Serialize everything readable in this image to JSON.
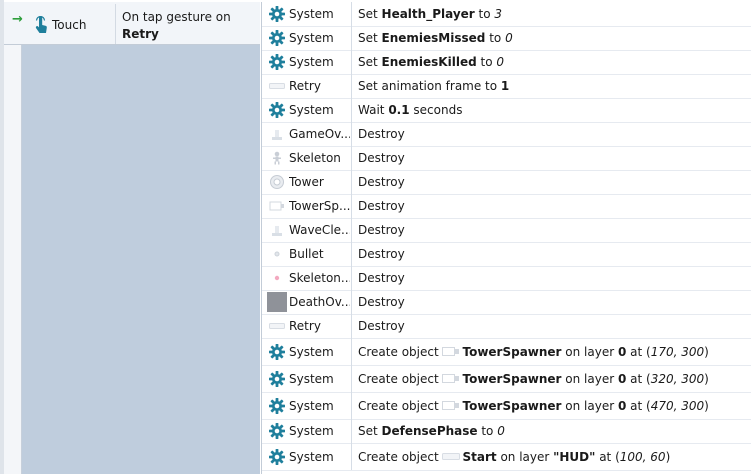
{
  "event": {
    "condition": {
      "object": "Touch",
      "text_line1": "On tap gesture on",
      "text_line2": "Retry"
    }
  },
  "actions": [
    {
      "icon": "gear-icon",
      "object": "System",
      "parts": [
        {
          "t": "Set "
        },
        {
          "b": "Health_Player"
        },
        {
          "t": " to "
        },
        {
          "i": "3"
        }
      ]
    },
    {
      "icon": "gear-icon",
      "object": "System",
      "parts": [
        {
          "t": "Set "
        },
        {
          "b": "EnemiesMissed"
        },
        {
          "t": " to "
        },
        {
          "i": "0"
        }
      ]
    },
    {
      "icon": "gear-icon",
      "object": "System",
      "parts": [
        {
          "t": "Set "
        },
        {
          "b": "EnemiesKilled"
        },
        {
          "t": " to "
        },
        {
          "i": "0"
        }
      ]
    },
    {
      "icon": "button-sprite-icon",
      "object": "Retry",
      "parts": [
        {
          "t": "Set animation frame to "
        },
        {
          "b": "1"
        }
      ]
    },
    {
      "icon": "gear-icon",
      "object": "System",
      "parts": [
        {
          "t": "Wait "
        },
        {
          "b": "0.1"
        },
        {
          "t": " seconds"
        }
      ]
    },
    {
      "icon": "sprite-icon",
      "object": "GameOv...",
      "parts": [
        {
          "t": "Destroy"
        }
      ]
    },
    {
      "icon": "skeleton-sprite-icon",
      "object": "Skeleton",
      "parts": [
        {
          "t": "Destroy"
        }
      ]
    },
    {
      "icon": "tower-sprite-icon",
      "object": "Tower",
      "parts": [
        {
          "t": "Destroy"
        }
      ]
    },
    {
      "icon": "spawner-sprite-icon",
      "object": "TowerSp...",
      "parts": [
        {
          "t": "Destroy"
        }
      ]
    },
    {
      "icon": "sprite-icon",
      "object": "WaveCle...",
      "parts": [
        {
          "t": "Destroy"
        }
      ]
    },
    {
      "icon": "bullet-sprite-icon",
      "object": "Bullet",
      "parts": [
        {
          "t": "Destroy"
        }
      ]
    },
    {
      "icon": "pink-dot-sprite-icon",
      "object": "Skeleton...",
      "parts": [
        {
          "t": "Destroy"
        }
      ]
    },
    {
      "icon": "gray-square-sprite-icon",
      "object": "DeathOv...",
      "parts": [
        {
          "t": "Destroy"
        }
      ]
    },
    {
      "icon": "button-sprite-icon",
      "object": "Retry",
      "parts": [
        {
          "t": "Destroy"
        }
      ]
    },
    {
      "icon": "gear-icon",
      "object": "System",
      "parts": [
        {
          "t": "Create object "
        },
        {
          "icon": "spawner-mini-icon"
        },
        {
          "b": "TowerSpawner"
        },
        {
          "t": " on layer "
        },
        {
          "b": "0"
        },
        {
          "t": " at ("
        },
        {
          "i": "170, 300"
        },
        {
          "t": ")"
        }
      ]
    },
    {
      "icon": "gear-icon",
      "object": "System",
      "parts": [
        {
          "t": "Create object "
        },
        {
          "icon": "spawner-mini-icon"
        },
        {
          "b": "TowerSpawner"
        },
        {
          "t": " on layer "
        },
        {
          "b": "0"
        },
        {
          "t": " at ("
        },
        {
          "i": "320, 300"
        },
        {
          "t": ")"
        }
      ]
    },
    {
      "icon": "gear-icon",
      "object": "System",
      "parts": [
        {
          "t": "Create object "
        },
        {
          "icon": "spawner-mini-icon"
        },
        {
          "b": "TowerSpawner"
        },
        {
          "t": " on layer "
        },
        {
          "b": "0"
        },
        {
          "t": " at ("
        },
        {
          "i": "470, 300"
        },
        {
          "t": ")"
        }
      ]
    },
    {
      "icon": "gear-icon",
      "object": "System",
      "parts": [
        {
          "t": "Set "
        },
        {
          "b": "DefensePhase"
        },
        {
          "t": " to "
        },
        {
          "i": "0"
        }
      ]
    },
    {
      "icon": "gear-icon",
      "object": "System",
      "parts": [
        {
          "t": "Create object "
        },
        {
          "icon": "button-mini-icon"
        },
        {
          "b": "Start"
        },
        {
          "t": " on layer "
        },
        {
          "b": "\"HUD\""
        },
        {
          "t": " at ("
        },
        {
          "i": "100, 60"
        },
        {
          "t": ")"
        }
      ]
    }
  ],
  "colors": {
    "gear": "#1f7f9c",
    "event_block": "#bfcddd",
    "touch_icon": "#1f7f9c",
    "arrow": "#2e9e3c"
  }
}
